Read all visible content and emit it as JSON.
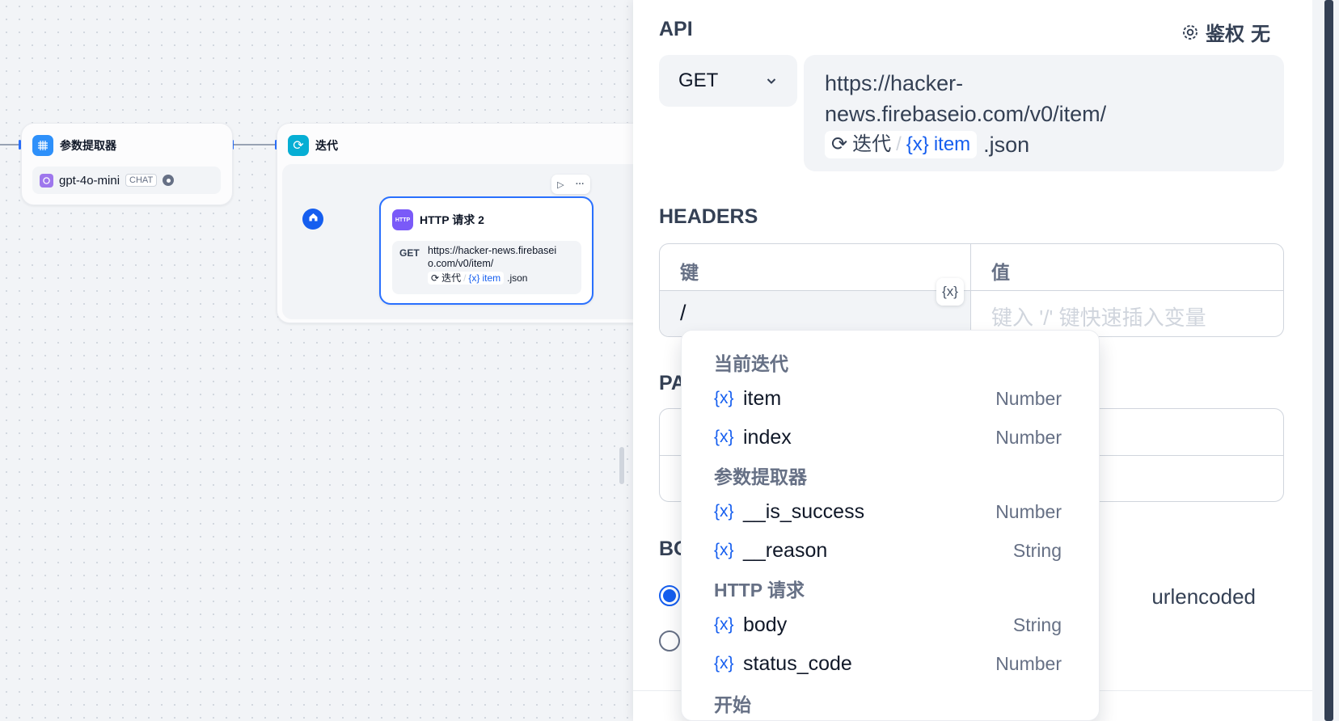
{
  "canvas": {
    "param_node": {
      "title": "参数提取器",
      "model": "gpt-4o-mini",
      "model_badge": "CHAT"
    },
    "iter_node": {
      "title": "迭代"
    },
    "http_node": {
      "title": "HTTP 请求 2",
      "method": "GET",
      "url_line1": "https://hacker-news.firebasei",
      "url_line2": "o.com/v0/item/",
      "var_node": "迭代",
      "var_sep": "/",
      "var_name": "item",
      "suffix": ".json"
    }
  },
  "panel": {
    "api": {
      "title": "API",
      "auth_label": "鉴权",
      "auth_value": "无",
      "method": "GET",
      "url_line1": "https://hacker-",
      "url_line2": "news.firebaseio.com/v0/item/",
      "var_node": "迭代",
      "var_sep": "/",
      "var_name": "item",
      "suffix": ".json"
    },
    "headers": {
      "title": "HEADERS",
      "col_key": "键",
      "col_value": "值",
      "key_input": "/",
      "value_placeholder": "键入 '/' 键快速插入变量",
      "var_button": "{x}"
    },
    "params_title": "PA",
    "body": {
      "title": "BO",
      "option_text": "urlencoded"
    }
  },
  "dropdown": {
    "groups": [
      {
        "label": "当前迭代",
        "items": [
          {
            "name": "item",
            "type": "Number"
          },
          {
            "name": "index",
            "type": "Number"
          }
        ]
      },
      {
        "label": "参数提取器",
        "items": [
          {
            "name": "__is_success",
            "type": "Number"
          },
          {
            "name": "__reason",
            "type": "String"
          }
        ]
      },
      {
        "label": "HTTP 请求",
        "items": [
          {
            "name": "body",
            "type": "String"
          },
          {
            "name": "status_code",
            "type": "Number"
          }
        ]
      },
      {
        "label": "开始",
        "items": []
      }
    ],
    "var_icon": "{x}"
  },
  "colors": {
    "accent": "#155eef",
    "edge": "#2970ff",
    "panel_bg": "#ffffff",
    "canvas_bg": "#f2f4f7"
  }
}
